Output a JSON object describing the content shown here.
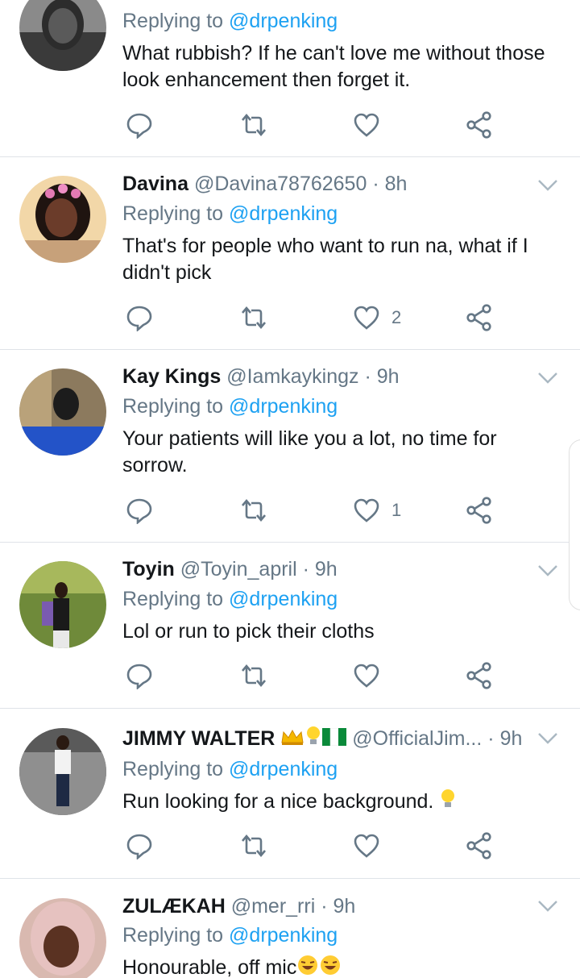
{
  "replies": [
    {
      "name": "",
      "handle": "",
      "time": "",
      "replying_label": "Replying to ",
      "replying_to": "@drpenking",
      "text": "What rubbish? If he can't love me without those look enhancement then forget it.",
      "likes": ""
    },
    {
      "name": "Davina",
      "handle": "@Davina78762650",
      "time": "8h",
      "replying_label": "Replying to ",
      "replying_to": "@drpenking",
      "text": "That's for people who want to run na, what if I didn't pick",
      "likes": "2"
    },
    {
      "name": "Kay Kings",
      "handle": "@Iamkaykingz",
      "time": "9h",
      "replying_label": "Replying to ",
      "replying_to": "@drpenking",
      "text": "Your patients will like you a lot, no time for sorrow.",
      "likes": "1"
    },
    {
      "name": "Toyin",
      "handle": "@Toyin_april",
      "time": "9h",
      "replying_label": "Replying to ",
      "replying_to": "@drpenking",
      "text": "Lol or run to pick their cloths",
      "likes": ""
    },
    {
      "name": "JIMMY WALTER",
      "handle": "@OfficialJim...",
      "time": "9h",
      "replying_label": "Replying to ",
      "replying_to": "@drpenking",
      "text": "Run looking for a nice background.",
      "likes": ""
    },
    {
      "name": "ZULÆKAH",
      "handle": "@mer_rri",
      "time": "9h",
      "replying_label": "Replying to ",
      "replying_to": "@drpenking",
      "text": "Honourable, off mic",
      "likes": ""
    }
  ],
  "separator": "·",
  "icons": {
    "reply": "reply-icon",
    "retweet": "retweet-icon",
    "like": "like-icon",
    "share": "share-icon",
    "more": "chevron-down-icon"
  },
  "colors": {
    "accent": "#1da1f2",
    "muted": "#657786",
    "divider": "#dfe3e8"
  }
}
